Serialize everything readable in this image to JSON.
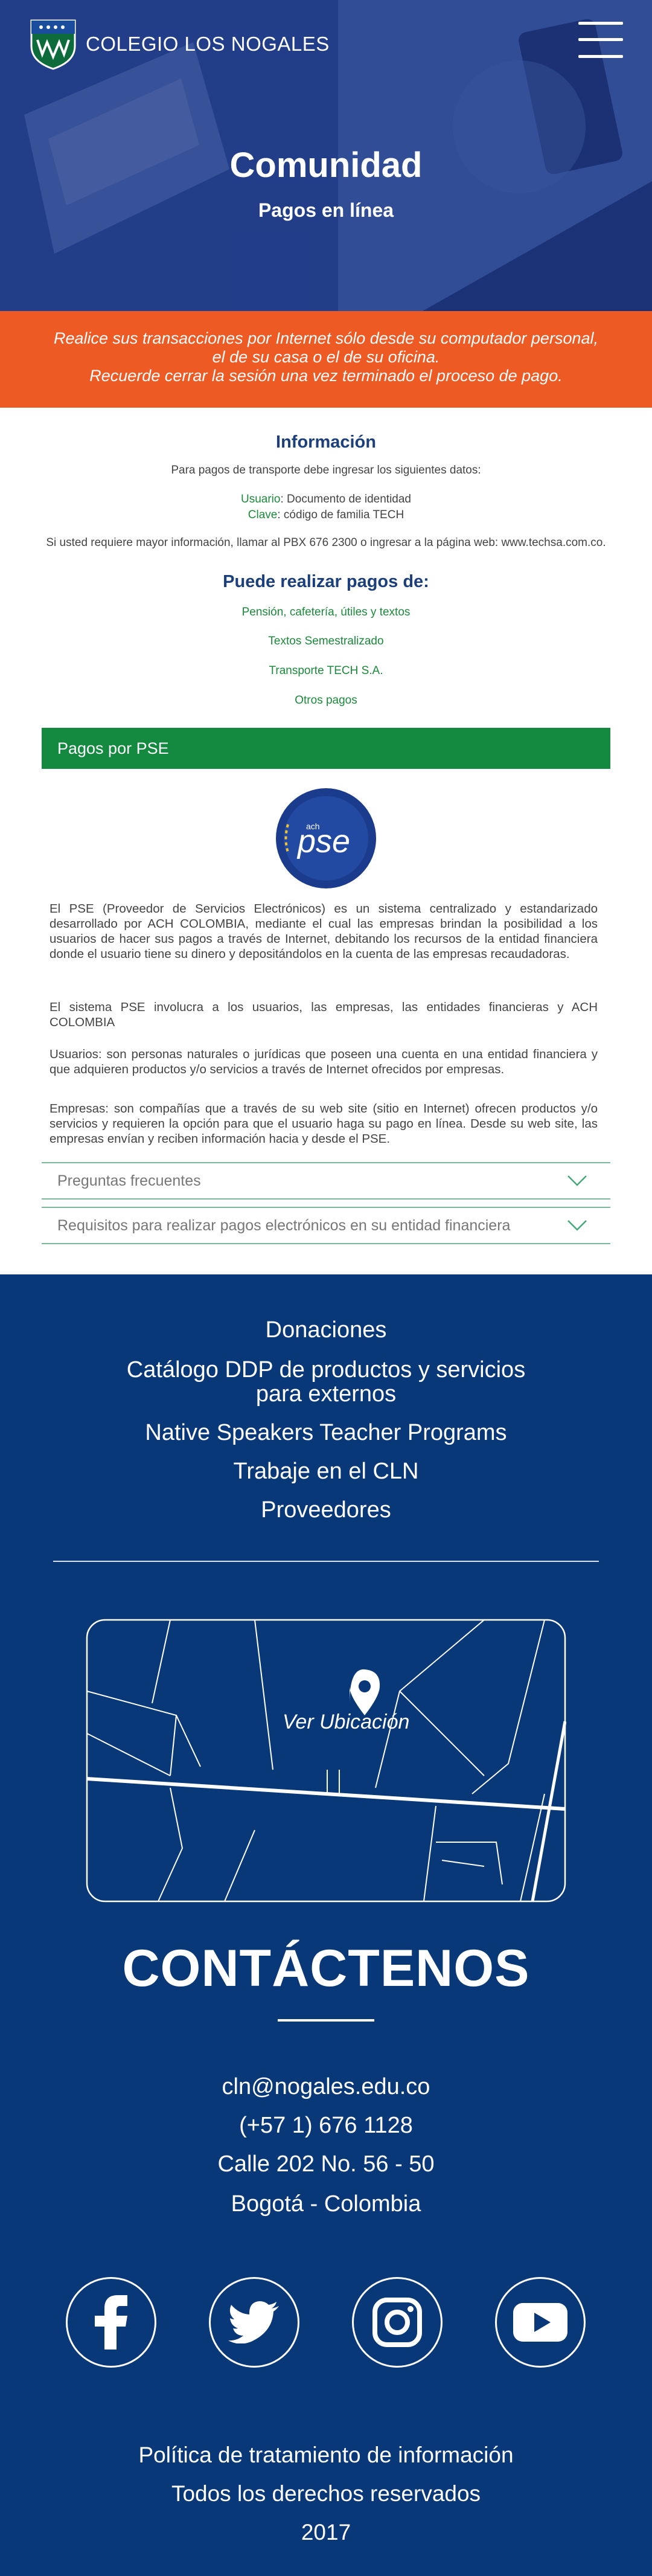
{
  "header": {
    "logo_text": "COLEGIO LOS NOGALES",
    "title": "Comunidad",
    "subtitle": "Pagos en línea"
  },
  "notice": {
    "line1": "Realice sus transacciones por Internet sólo desde su computador personal,",
    "line2": "el de su casa o el de su oficina.",
    "line3": "Recuerde cerrar la sesión una vez terminado el proceso de pago."
  },
  "info": {
    "heading": "Información",
    "intro": "Para pagos de transporte debe ingresar los siguientes datos:",
    "usuario_label": "Usuario",
    "usuario_value": ": Documento de identidad",
    "clave_label": "Clave",
    "clave_value": ": código de familia TECH",
    "more": "Si usted requiere mayor información, llamar al PBX 676 2300 o ingresar a la página web: www.techsa.com.co."
  },
  "payments": {
    "heading": "Puede realizar pagos de:",
    "links": [
      "Pensión, cafetería, útiles y textos",
      "Textos Semestralizado",
      "Transporte TECH S.A.",
      "Otros pagos"
    ]
  },
  "pse": {
    "bar_label": "Pagos por PSE",
    "logo_small": "ach",
    "logo_text": "pse",
    "paragraphs": [
      "El PSE (Proveedor de Servicios Electrónicos) es un sistema centralizado y estandarizado desarrollado por ACH COLOMBIA, mediante el cual las empresas brindan la posibilidad a los usuarios de hacer sus pagos a través de Internet, debitando los recursos de la entidad financiera donde el usuario tiene su dinero y depositándolos en la cuenta de las empresas recaudadoras.",
      "El sistema PSE involucra a los usuarios, las empresas, las entidades financieras y ACH COLOMBIA",
      "Usuarios: son personas naturales o jurídicas que poseen una cuenta en una entidad financiera y que adquieren productos y/o servicios a través de Internet ofrecidos por empresas.",
      "Empresas: son compañías que a través de su web site (sitio en Internet) ofrecen productos y/o servicios y requieren la opción para que el usuario haga su pago en línea. Desde su web site, las empresas envían y reciben información hacia y desde el PSE."
    ],
    "accordion": [
      "Preguntas frecuentes",
      "Requisitos para realizar pagos electrónicos en su entidad financiera"
    ]
  },
  "footer": {
    "links": [
      "Donaciones",
      "Catálogo DDP de productos y servicios",
      "para externos",
      "Native Speakers Teacher Programs",
      "Trabaje en el CLN",
      "Proveedores"
    ],
    "map_label": "Ver Ubicación",
    "contact_heading": "CONTÁCTENOS",
    "email": "cln@nogales.edu.co",
    "phone": "(+57 1) 676 1128",
    "address": "Calle 202 No. 56 - 50",
    "city": "Bogotá - Colombia",
    "social_icons": [
      "facebook-icon",
      "twitter-icon",
      "instagram-icon",
      "youtube-icon"
    ],
    "legal1": "Política de tratamiento de información",
    "legal2": "Todos los derechos reservados",
    "year": "2017"
  },
  "colors": {
    "brand_blue": "#093879",
    "accent_orange": "#ee5a24",
    "green": "#138a3f"
  }
}
